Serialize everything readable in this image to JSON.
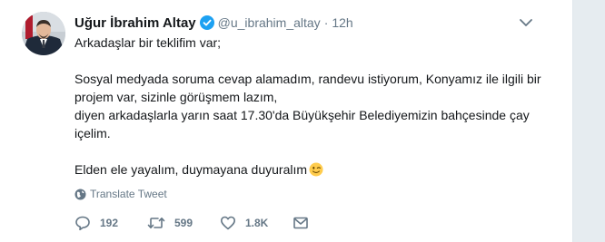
{
  "user": {
    "name": "Uğur İbrahim Altay",
    "handle": "@u_ibrahim_altay",
    "separator": "·",
    "time": "12h"
  },
  "tweet": {
    "lines": [
      "Arkadaşlar bir teklifim var;",
      "Sosyal medyada soruma cevap alamadım, randevu istiyorum, Konyamız ile ilgili bir projem var, sizinle görüşmem lazım,",
      "diyen arkadaşlarla yarın saat 17.30'da Büyükşehir Belediyemizin bahçesinde çay içelim.",
      "Elden ele yayalım, duymayana duyuralım"
    ],
    "emoji": "winking-face-icon"
  },
  "translate_label": "Translate Tweet",
  "actions": {
    "reply_count": "192",
    "retweet_count": "599",
    "like_count": "1.8K"
  },
  "colors": {
    "text": "#14171a",
    "secondary": "#657786",
    "verified": "#1da1f2",
    "background": "#e6ecf0"
  },
  "icons": {
    "reply": "reply-icon",
    "retweet": "retweet-icon",
    "like": "heart-icon",
    "message": "envelope-icon",
    "globe": "globe-icon",
    "caret": "chevron-down-icon",
    "verified": "verified-badge-icon"
  }
}
